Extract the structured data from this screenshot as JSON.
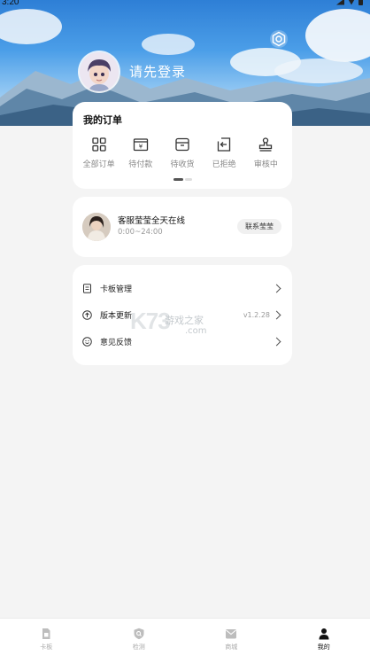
{
  "status_bar": {
    "time": "3:20"
  },
  "profile": {
    "login_prompt": "请先登录"
  },
  "orders": {
    "title": "我的订单",
    "items": [
      {
        "label": "全部订单",
        "icon": "grid-icon"
      },
      {
        "label": "待付款",
        "icon": "yuan-wallet-icon"
      },
      {
        "label": "待收货",
        "icon": "box-icon"
      },
      {
        "label": "已拒绝",
        "icon": "return-icon"
      },
      {
        "label": "审核中",
        "icon": "stamp-icon"
      }
    ]
  },
  "service": {
    "title": "客服莹莹全天在线",
    "hours": "0:00~24:00",
    "contact_label": "联系莹莹"
  },
  "menu": {
    "items": [
      {
        "label": "卡板管理",
        "value": "",
        "icon": "card-board-icon"
      },
      {
        "label": "版本更新",
        "value": "v1.2.28",
        "icon": "upload-circle-icon"
      },
      {
        "label": "意见反馈",
        "value": "",
        "icon": "smile-icon"
      }
    ]
  },
  "watermark": {
    "main": "K73",
    "sub": "游戏之家",
    "domain": ".com"
  },
  "tabbar": {
    "items": [
      {
        "label": "卡板",
        "icon": "sim-card-icon",
        "active": false
      },
      {
        "label": "检测",
        "icon": "shield-icon",
        "active": false
      },
      {
        "label": "商城",
        "icon": "mail-bag-icon",
        "active": false
      },
      {
        "label": "我的",
        "icon": "person-icon",
        "active": true
      }
    ]
  },
  "colors": {
    "accent": "#111111",
    "inactive": "#aaaaaa",
    "background": "#f4f4f4"
  }
}
